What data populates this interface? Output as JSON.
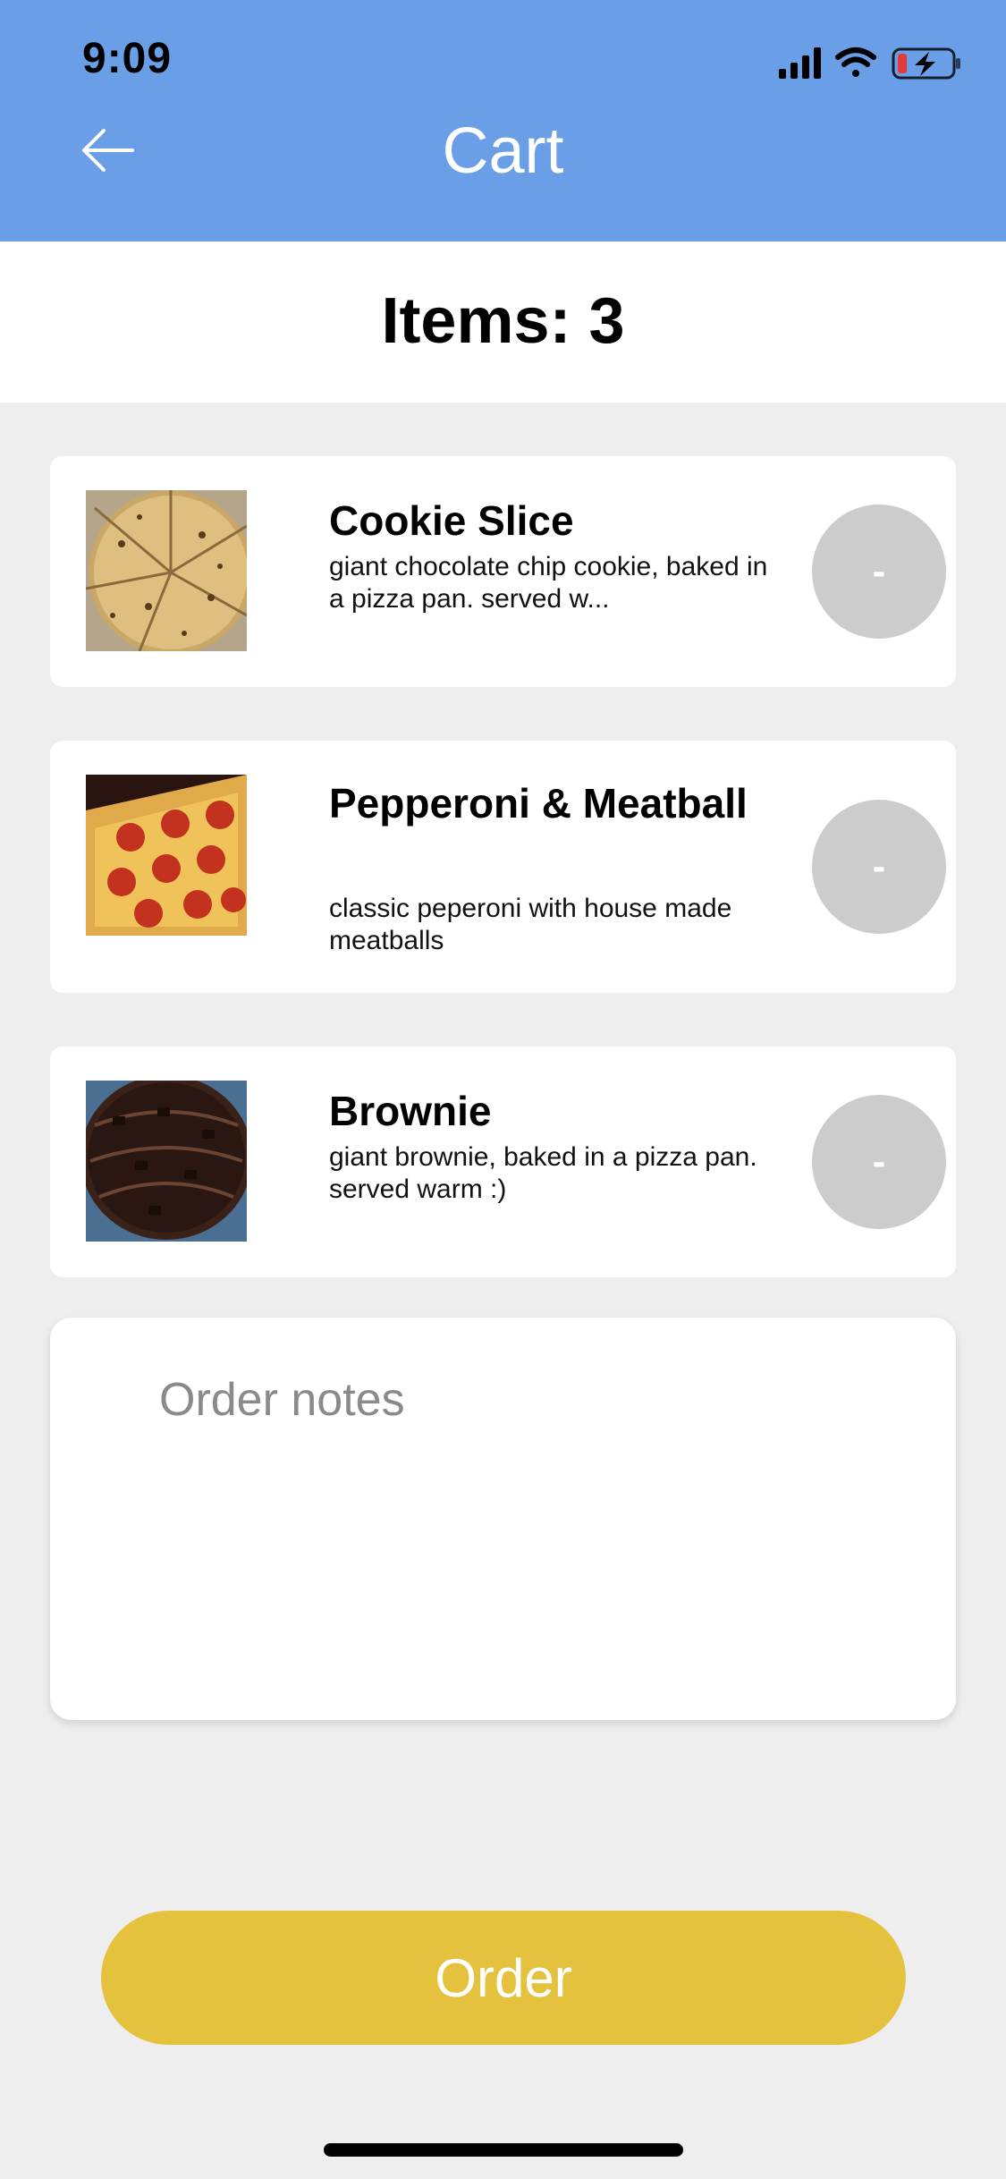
{
  "status_bar": {
    "time": "9:09",
    "icons": [
      "cellular-signal-icon",
      "wifi-icon",
      "battery-charging-icon"
    ]
  },
  "header": {
    "title": "Cart",
    "back_icon": "arrow-left-icon",
    "background_color": "#6a9ee7"
  },
  "cart": {
    "count_label": "Items: 3"
  },
  "items": [
    {
      "name": "Cookie Slice",
      "description": "giant chocolate chip cookie, baked in a pizza pan. served w...",
      "image": "cookie-pizza-photo",
      "remove_label": "-"
    },
    {
      "name": "Pepperoni & Meatball",
      "description": "classic peperoni with house made meatballs",
      "image": "pepperoni-pizza-photo",
      "remove_label": "-"
    },
    {
      "name": "Brownie",
      "description": "giant brownie, baked in a pizza pan. served warm :)",
      "image": "brownie-pizza-photo",
      "remove_label": "-"
    }
  ],
  "notes": {
    "placeholder": "Order notes",
    "value": ""
  },
  "order_button": {
    "label": "Order",
    "color": "#e5c23e"
  }
}
